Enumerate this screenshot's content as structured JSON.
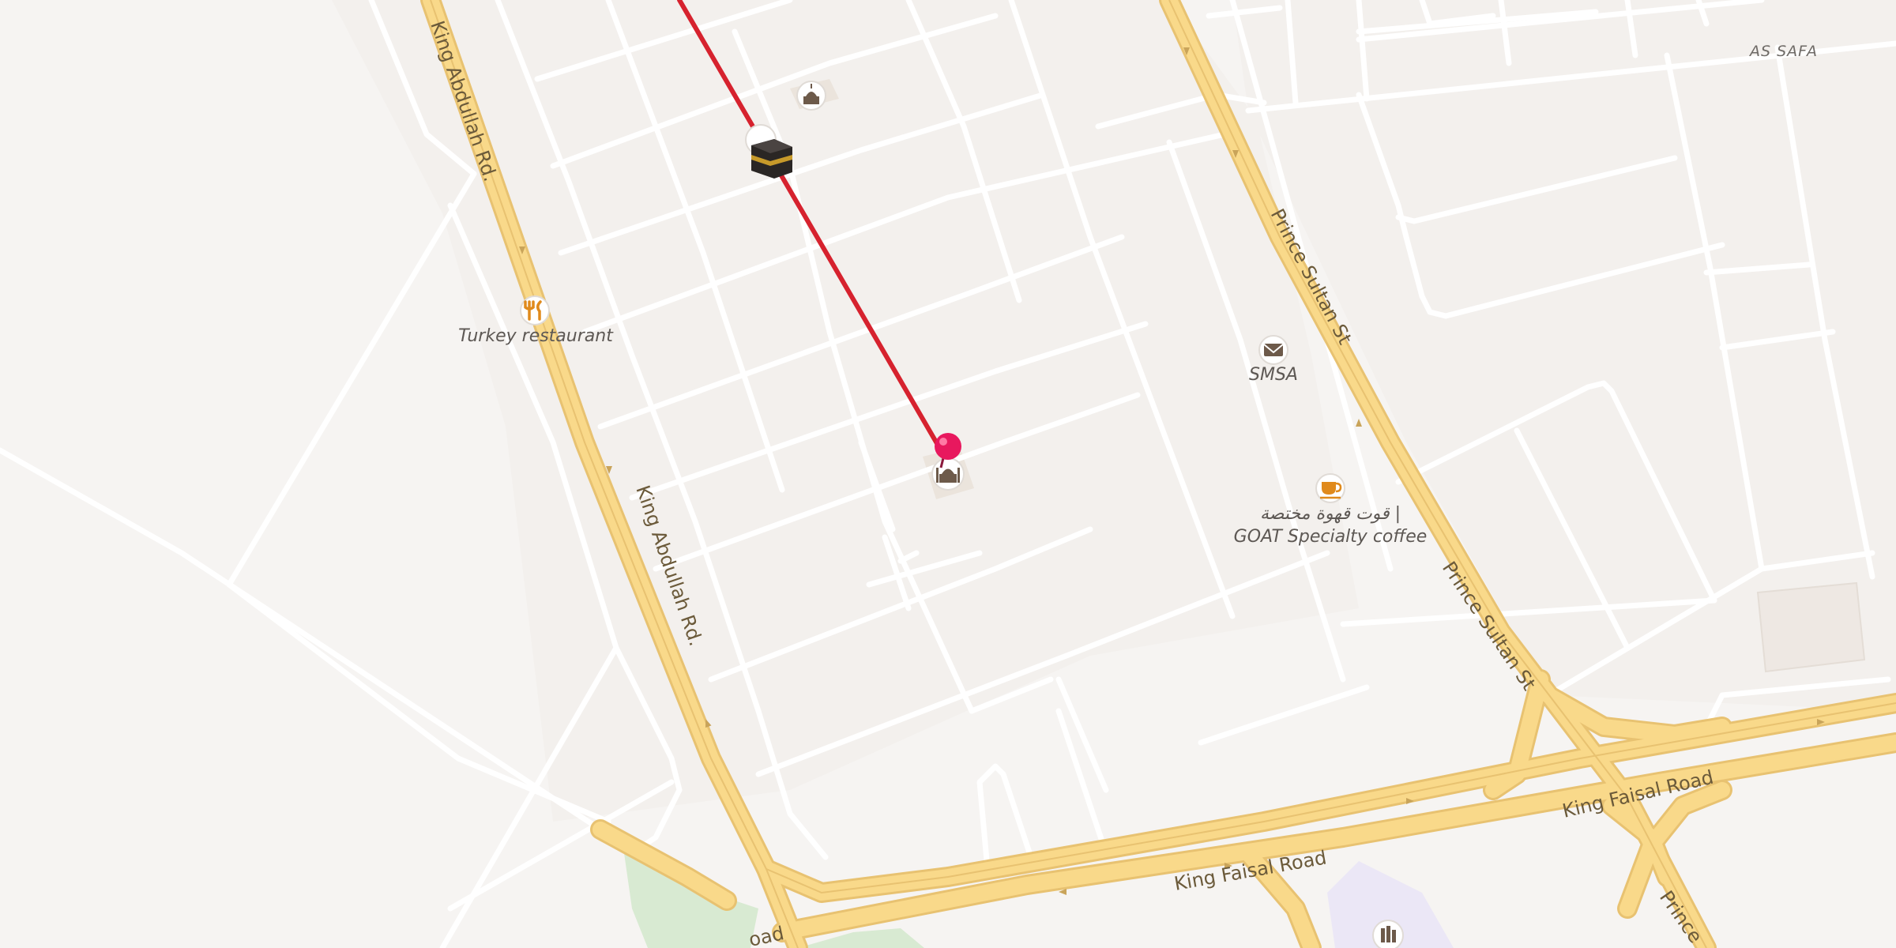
{
  "map": {
    "area_label": "AS SAFA",
    "streets": {
      "king_abdullah_1": "King Abdullah Rd.",
      "king_abdullah_2": "King Abdullah Rd.",
      "prince_sultan_1": "Prince Sultan St",
      "prince_sultan_2": "Prince Sultan St",
      "prince_sultan_3": "Prince",
      "king_faisal_1": "King Faisal Road",
      "king_faisal_2": "King Faisal Road",
      "road_partial": "oad"
    },
    "pois": [
      {
        "id": "turkey-restaurant",
        "label": "Turkey restaurant",
        "icon": "restaurant-icon"
      },
      {
        "id": "smsa",
        "label": "SMSA",
        "icon": "mail-icon"
      },
      {
        "id": "goat-coffee",
        "label_ar": "قوت قهوة مختصة |",
        "label": "GOAT Specialty coffee",
        "icon": "coffee-icon"
      },
      {
        "id": "mosque-top",
        "icon": "mosque-icon"
      },
      {
        "id": "mosque-marker",
        "icon": "mosque-icon"
      },
      {
        "id": "kaaba",
        "icon": "kaaba-icon"
      },
      {
        "id": "library",
        "icon": "library-icon"
      }
    ],
    "colors": {
      "background": "#f6f4f2",
      "block": "#f3f0ed",
      "minor_road": "#ffffff",
      "major_road": "#f9d98a",
      "major_road_casing": "#e8c271",
      "route_line": "#d6222e",
      "pin": "#e8185e",
      "park": "#d8ead2",
      "school": "#ebe7f6"
    }
  }
}
